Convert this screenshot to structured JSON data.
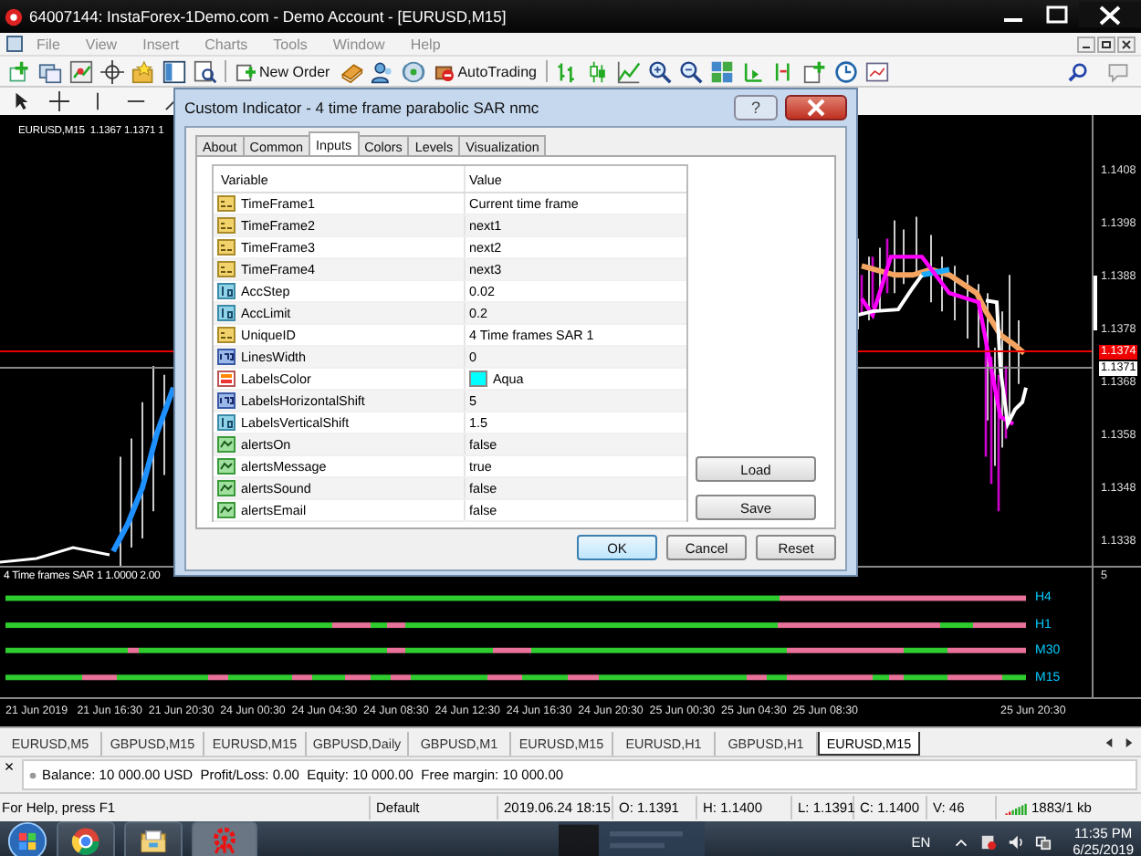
{
  "window": {
    "title": "64007144: InstaForex-1Demo.com - Demo Account - [EURUSD,M15]"
  },
  "menu": [
    "File",
    "View",
    "Insert",
    "Charts",
    "Tools",
    "Window",
    "Help"
  ],
  "toolbar": {
    "new_order": "New Order",
    "autotrading": "AutoTrading"
  },
  "chart": {
    "label": "EURUSD,M15  1.1367 1.1371 1",
    "price_axis": [
      {
        "text": "1.1408",
        "kind": "tick"
      },
      {
        "text": "1.1398",
        "kind": "tick"
      },
      {
        "text": "1.1388",
        "kind": "tick"
      },
      {
        "text": "1.1378",
        "kind": "tick"
      },
      {
        "text": "1.1374",
        "kind": "ask"
      },
      {
        "text": "1.1371",
        "kind": "bid"
      },
      {
        "text": "1.1368",
        "kind": "tick"
      },
      {
        "text": "1.1358",
        "kind": "tick"
      },
      {
        "text": "1.1348",
        "kind": "tick"
      },
      {
        "text": "1.1338",
        "kind": "tick"
      }
    ],
    "indicator_label": "4 Time frames SAR 1 1.0000 2.00",
    "indicator_axis": "5",
    "timeframes": [
      "H4",
      "H1",
      "M30",
      "M15"
    ],
    "time_axis": [
      "21 Jun 2019",
      "21 Jun 16:30",
      "21 Jun 20:30",
      "24 Jun 00:30",
      "24 Jun 04:30",
      "24 Jun 08:30",
      "24 Jun 12:30",
      "24 Jun 16:30",
      "24 Jun 20:30",
      "25 Jun 00:30",
      "25 Jun 04:30",
      "25 Jun 08:30",
      "25 Jun 20:30"
    ]
  },
  "dialog": {
    "title": "Custom Indicator - 4 time frame parabolic SAR nmc",
    "help": "?",
    "tabs": [
      {
        "label": "About",
        "selected": false
      },
      {
        "label": "Common",
        "selected": false
      },
      {
        "label": "Inputs",
        "selected": true
      },
      {
        "label": "Colors",
        "selected": false
      },
      {
        "label": "Levels",
        "selected": false
      },
      {
        "label": "Visualization",
        "selected": false
      }
    ],
    "columns": [
      "Variable",
      "Value"
    ],
    "rows": [
      {
        "kind": "string",
        "name": "TimeFrame1",
        "value": "Current time frame"
      },
      {
        "kind": "string",
        "name": "TimeFrame2",
        "value": "next1"
      },
      {
        "kind": "string",
        "name": "TimeFrame3",
        "value": "next2"
      },
      {
        "kind": "string",
        "name": "TimeFrame4",
        "value": "next3"
      },
      {
        "kind": "double",
        "name": "AccStep",
        "value": "0.02"
      },
      {
        "kind": "double",
        "name": "AccLimit",
        "value": "0.2"
      },
      {
        "kind": "string",
        "name": "UniqueID",
        "value": "4 Time frames SAR 1"
      },
      {
        "kind": "int",
        "name": "LinesWidth",
        "value": "0"
      },
      {
        "kind": "color",
        "name": "LabelsColor",
        "value": "Aqua",
        "color": "#00ffff"
      },
      {
        "kind": "int",
        "name": "LabelsHorizontalShift",
        "value": "5"
      },
      {
        "kind": "double",
        "name": "LabelsVerticalShift",
        "value": "1.5"
      },
      {
        "kind": "bool",
        "name": "alertsOn",
        "value": "false"
      },
      {
        "kind": "bool",
        "name": "alertsMessage",
        "value": "true"
      },
      {
        "kind": "bool",
        "name": "alertsSound",
        "value": "false"
      },
      {
        "kind": "bool",
        "name": "alertsEmail",
        "value": "false"
      }
    ],
    "side_buttons": [
      "Load",
      "Save"
    ],
    "buttons": [
      "OK",
      "Cancel",
      "Reset"
    ]
  },
  "chart_tabs": [
    {
      "label": "EURUSD,M5",
      "selected": false
    },
    {
      "label": "GBPUSD,M15",
      "selected": false
    },
    {
      "label": "EURUSD,M15",
      "selected": false
    },
    {
      "label": "GBPUSD,Daily",
      "selected": false
    },
    {
      "label": "GBPUSD,M1",
      "selected": false
    },
    {
      "label": "EURUSD,M15",
      "selected": false
    },
    {
      "label": "EURUSD,H1",
      "selected": false
    },
    {
      "label": "GBPUSD,H1",
      "selected": false
    },
    {
      "label": "EURUSD,M15",
      "selected": true
    }
  ],
  "terminal": {
    "close": "×",
    "summary": "Balance: 10 000.00 USD  Profit/Loss: 0.00  Equity: 10 000.00  Free margin: 10 000.00"
  },
  "status_bar": [
    "For Help, press F1",
    "Default",
    "2019.06.24 18:15",
    "O: 1.1391",
    "H: 1.1400",
    "L: 1.1391",
    "C: 1.1400",
    "V: 46",
    "1883/1 kb"
  ],
  "taskbar": {
    "language": "EN",
    "time": "11:35 PM",
    "date": "6/25/2019"
  }
}
